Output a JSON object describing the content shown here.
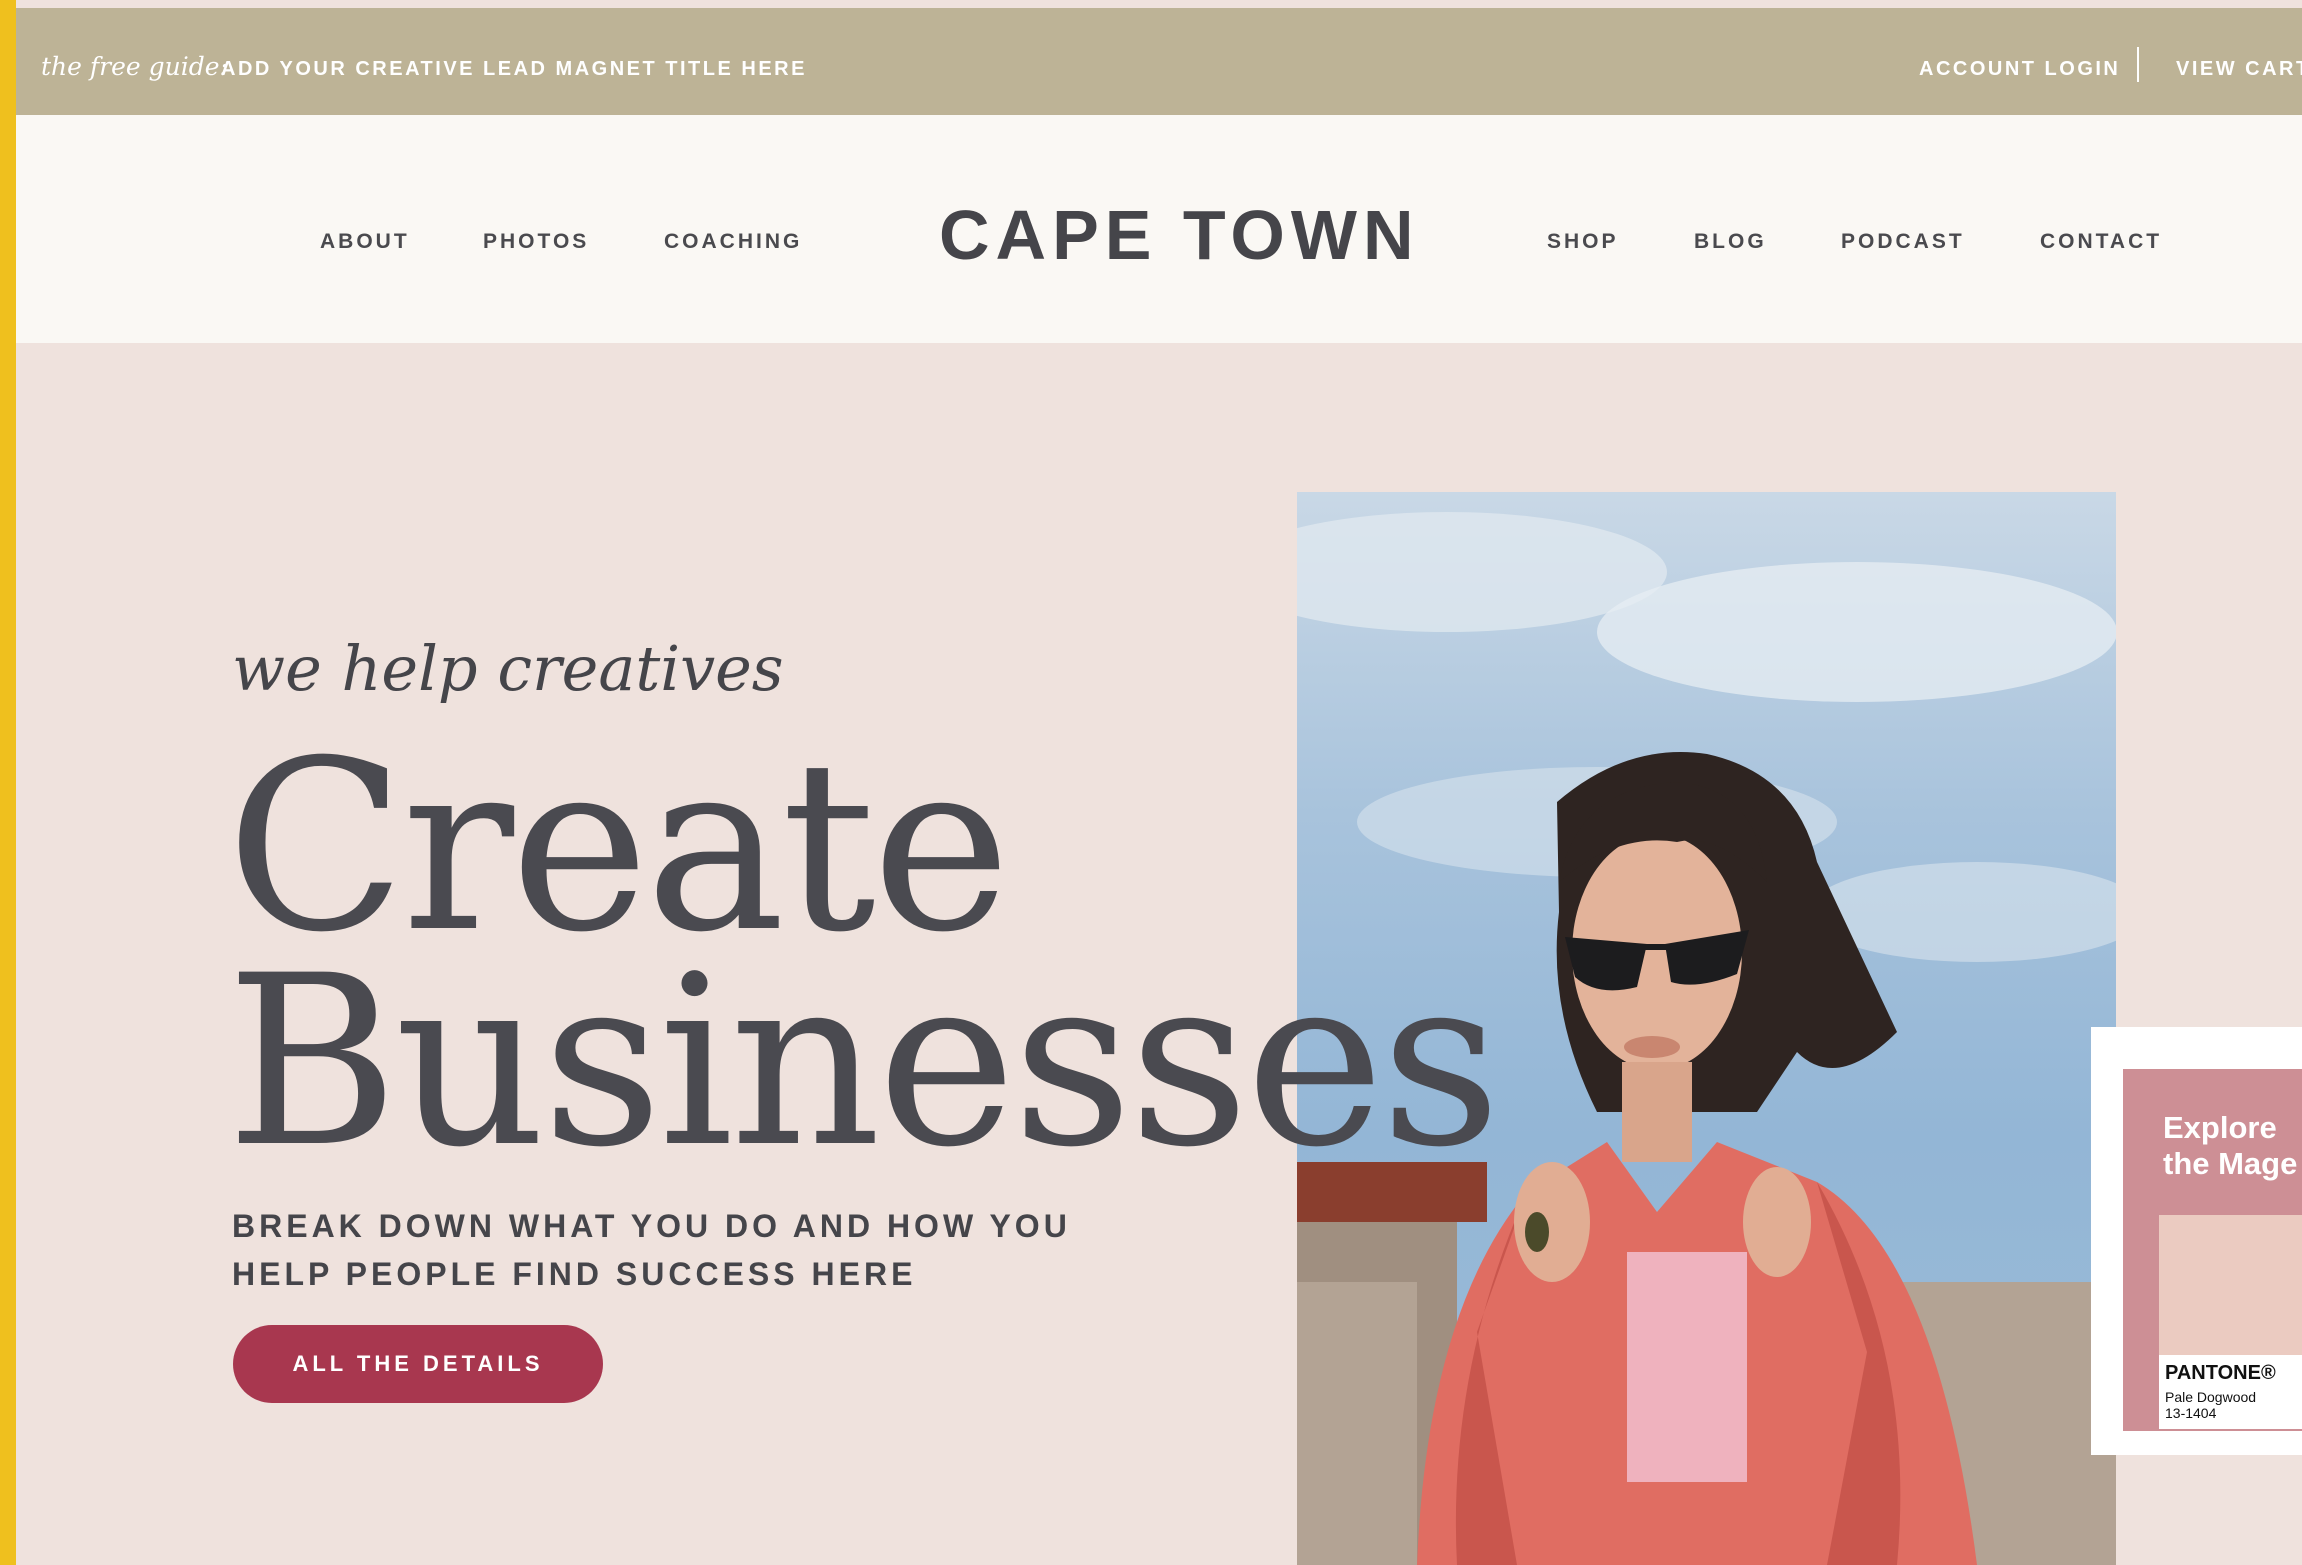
{
  "topbar": {
    "guide_label": "the free guide:",
    "guide_title": "ADD YOUR CREATIVE LEAD MAGNET TITLE HERE",
    "account_login": "ACCOUNT LOGIN",
    "view_cart": "VIEW CART"
  },
  "nav": {
    "left": [
      "ABOUT",
      "PHOTOS",
      "COACHING"
    ],
    "brand": "CAPE TOWN",
    "right": [
      "SHOP",
      "BLOG",
      "PODCAST",
      "CONTACT"
    ]
  },
  "hero": {
    "script_line": "we help creatives",
    "headline_line1": "Create",
    "headline_line2": "Businesses",
    "subtext_line1": "BREAK DOWN WHAT YOU DO AND HOW YOU",
    "subtext_line2": "HELP PEOPLE FIND SUCCESS HERE",
    "cta_label": "ALL THE DETAILS",
    "photo_icon": "woman-in-pink-jacket-photo"
  },
  "promo": {
    "explore_line1": "Explore",
    "explore_line2": "the Mage",
    "pantone_brand": "PANTONE®",
    "pantone_name": "Pale Dogwood",
    "pantone_code": "13-1404"
  },
  "colors": {
    "outer_frame": "#efc01e",
    "topbar": "#bdb396",
    "navbar": "#faf8f4",
    "hero_bg": "#efe2dd",
    "text_dark": "#45454a",
    "cta": "#a8374f",
    "promo": "#cd8f95",
    "swatch": "#ebcbc1"
  }
}
